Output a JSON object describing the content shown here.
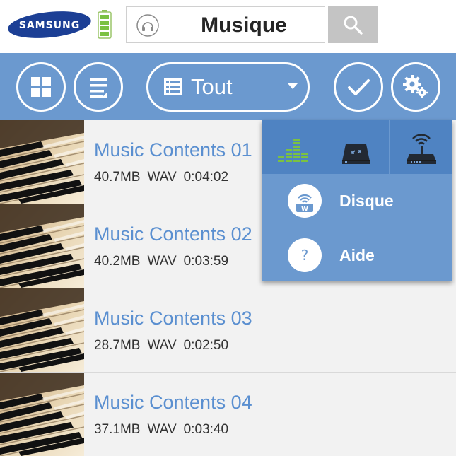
{
  "header": {
    "brand": "SAMSUNG",
    "title": "Musique",
    "icons": {
      "battery": "battery-icon",
      "headphones": "headphones-icon",
      "search": "search-icon"
    }
  },
  "toolbar": {
    "filter_label": "Tout",
    "icons": [
      "grid-view-icon",
      "list-view-icon",
      "list-icon",
      "chevron-down-icon",
      "check-icon",
      "settings-icon"
    ]
  },
  "tracks": [
    {
      "name": "Music Contents 01",
      "size": "40.7MB",
      "format": "WAV",
      "duration": "0:04:02"
    },
    {
      "name": "Music Contents 02",
      "size": "40.2MB",
      "format": "WAV",
      "duration": "0:03:59"
    },
    {
      "name": "Music Contents 03",
      "size": "28.7MB",
      "format": "WAV",
      "duration": "0:02:50"
    },
    {
      "name": "Music Contents 04",
      "size": "37.1MB",
      "format": "WAV",
      "duration": "0:03:40"
    }
  ],
  "menu": {
    "icons": [
      "equalizer-icon",
      "drive-expand-icon",
      "wifi-router-icon"
    ],
    "items": [
      {
        "label": "Disque",
        "icon": "wifi-drive-icon"
      },
      {
        "label": "Aide",
        "icon": "help-icon"
      }
    ]
  },
  "colors": {
    "toolbar": "#6b99cf",
    "menu_header": "#4f83c2",
    "accent_text": "#5a8fd0",
    "equalizer": "#7bc142",
    "row_background": "#f2f2f2"
  }
}
